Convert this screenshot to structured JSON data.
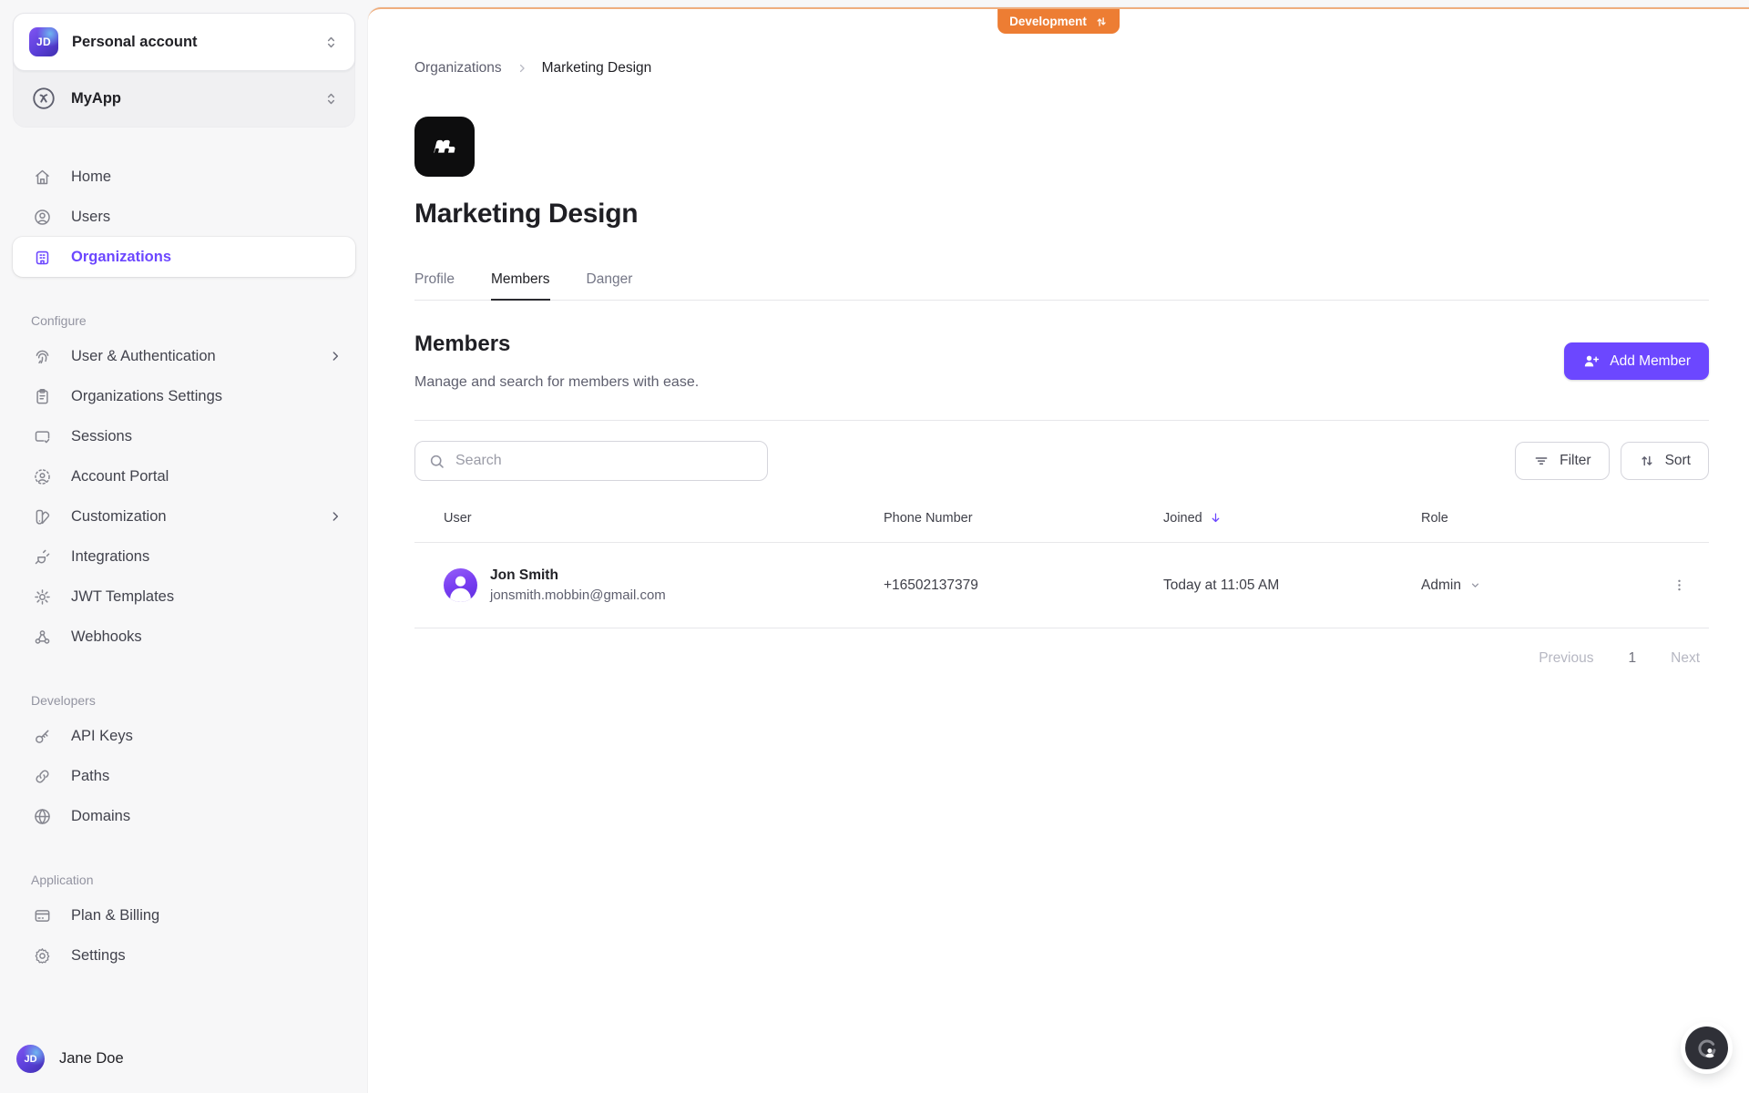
{
  "colors": {
    "accent": "#6C47FF",
    "development_badge": "#ED7D33"
  },
  "sidebar": {
    "switcher": {
      "personal": {
        "initials": "JD",
        "label": "Personal account"
      },
      "app": {
        "label": "MyApp"
      }
    },
    "nav": [
      {
        "icon": "home-icon",
        "label": "Home"
      },
      {
        "icon": "user-circle-icon",
        "label": "Users"
      },
      {
        "icon": "building-icon",
        "label": "Organizations",
        "active": true
      }
    ],
    "sections": [
      {
        "label": "Configure",
        "items": [
          {
            "icon": "fingerprint-icon",
            "label": "User & Authentication",
            "has_submenu": true
          },
          {
            "icon": "clipboard-icon",
            "label": "Organizations Settings"
          },
          {
            "icon": "session-card-icon",
            "label": "Sessions"
          },
          {
            "icon": "account-portal-icon",
            "label": "Account Portal"
          },
          {
            "icon": "swatch-icon",
            "label": "Customization",
            "has_submenu": true
          },
          {
            "icon": "plug-icon",
            "label": "Integrations"
          },
          {
            "icon": "cog-burst-icon",
            "label": "JWT Templates"
          },
          {
            "icon": "webhook-icon",
            "label": "Webhooks"
          }
        ]
      },
      {
        "label": "Developers",
        "items": [
          {
            "icon": "key-icon",
            "label": "API Keys"
          },
          {
            "icon": "link-icon",
            "label": "Paths"
          },
          {
            "icon": "globe-icon",
            "label": "Domains"
          }
        ]
      },
      {
        "label": "Application",
        "items": [
          {
            "icon": "credit-card-icon",
            "label": "Plan & Billing"
          },
          {
            "icon": "gear-icon",
            "label": "Settings"
          }
        ]
      }
    ],
    "footer": {
      "initials": "JD",
      "name": "Jane Doe"
    }
  },
  "header": {
    "environment_badge": "Development",
    "breadcrumb": {
      "parent": "Organizations",
      "current": "Marketing Design"
    }
  },
  "organization": {
    "title": "Marketing Design",
    "tabs": [
      {
        "label": "Profile"
      },
      {
        "label": "Members",
        "active": true
      },
      {
        "label": "Danger"
      }
    ]
  },
  "members": {
    "heading": "Members",
    "subtitle": "Manage and search for members with ease.",
    "add_button_label": "Add Member",
    "search_placeholder": "Search",
    "filter_label": "Filter",
    "sort_label": "Sort",
    "table": {
      "columns": {
        "user": "User",
        "phone": "Phone Number",
        "joined": "Joined",
        "role": "Role"
      },
      "sorted_by": "Joined",
      "sort_direction": "descending",
      "rows": [
        {
          "name": "Jon Smith",
          "email": "jonsmith.mobbin@gmail.com",
          "phone": "+16502137379",
          "joined": "Today at 11:05 AM",
          "role": "Admin"
        }
      ]
    },
    "pagination": {
      "previous_label": "Previous",
      "current_page": "1",
      "next_label": "Next"
    }
  }
}
